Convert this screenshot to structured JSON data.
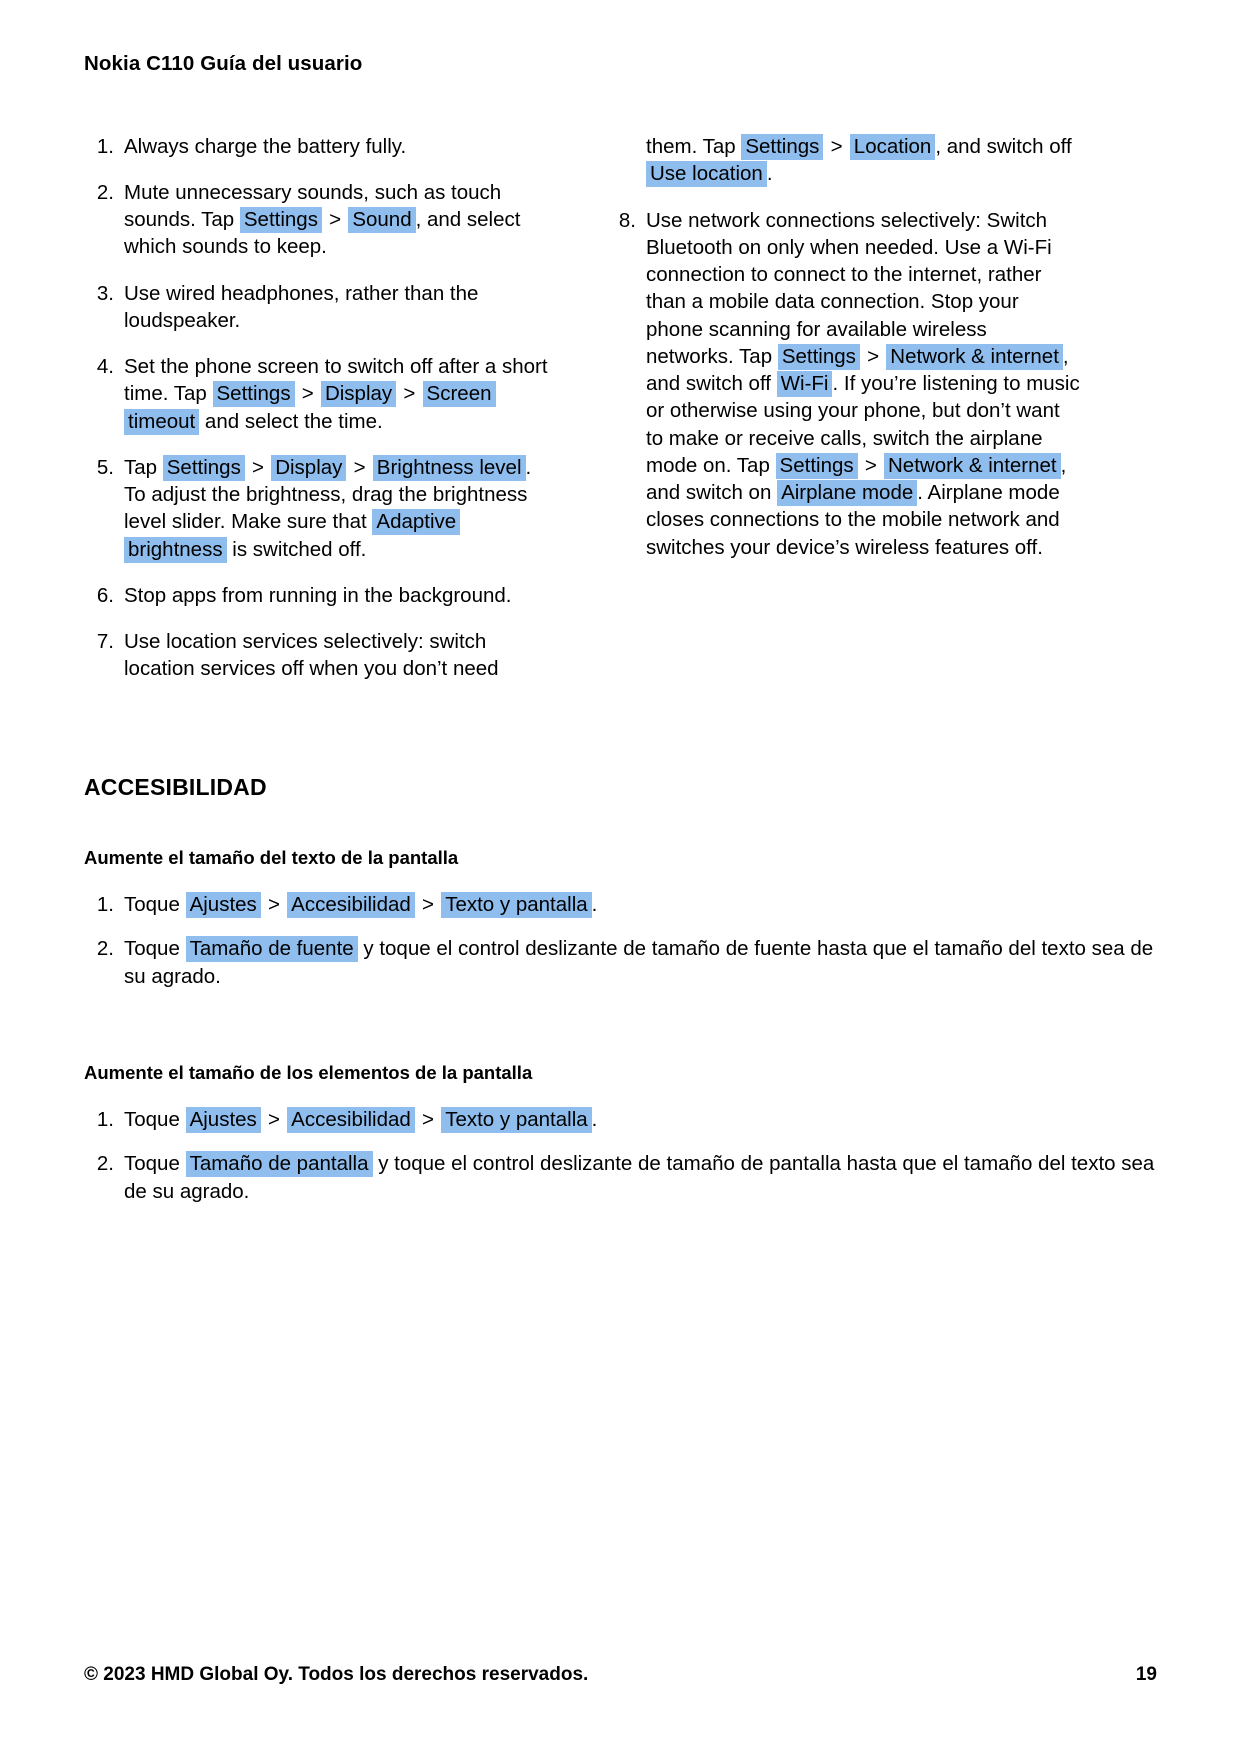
{
  "header": {
    "title": "Nokia C110 Guía del usuario"
  },
  "tips_left": [
    {
      "num": "1.",
      "parts": [
        {
          "t": "text",
          "v": "Always charge the battery fully."
        }
      ]
    },
    {
      "num": "2.",
      "parts": [
        {
          "t": "text",
          "v": "Mute unnecessary sounds, such as touch sounds. Tap "
        },
        {
          "t": "hl",
          "v": "Settings"
        },
        {
          "t": "sep",
          "v": ">"
        },
        {
          "t": "hl",
          "v": "Sound"
        },
        {
          "t": "text",
          "v": ", and select which sounds to keep."
        }
      ]
    },
    {
      "num": "3.",
      "parts": [
        {
          "t": "text",
          "v": "Use wired headphones, rather than the loudspeaker."
        }
      ]
    },
    {
      "num": "4.",
      "parts": [
        {
          "t": "text",
          "v": "Set the phone screen to switch off after a short time. Tap "
        },
        {
          "t": "hl",
          "v": "Settings"
        },
        {
          "t": "sep",
          "v": ">"
        },
        {
          "t": "hl",
          "v": "Display"
        },
        {
          "t": "sep",
          "v": ">"
        },
        {
          "t": "hl",
          "v": "Screen timeout"
        },
        {
          "t": "text",
          "v": " and select the time."
        }
      ]
    },
    {
      "num": "5.",
      "parts": [
        {
          "t": "text",
          "v": "Tap "
        },
        {
          "t": "hl",
          "v": "Settings"
        },
        {
          "t": "sep",
          "v": ">"
        },
        {
          "t": "hl",
          "v": "Display"
        },
        {
          "t": "sep",
          "v": ">"
        },
        {
          "t": "hl",
          "v": "Brightness level"
        },
        {
          "t": "text",
          "v": ". To adjust the brightness, drag the brightness level slider. Make sure that "
        },
        {
          "t": "hl",
          "v": "Adaptive brightness"
        },
        {
          "t": "text",
          "v": " is switched off."
        }
      ]
    },
    {
      "num": "6.",
      "parts": [
        {
          "t": "text",
          "v": "Stop apps from running in the background."
        }
      ]
    },
    {
      "num": "7.",
      "parts": [
        {
          "t": "text",
          "v": "Use location services selectively: switch location services off when you don’t need"
        }
      ]
    }
  ],
  "tips_right_continuation": {
    "parts": [
      {
        "t": "text",
        "v": "them. Tap "
      },
      {
        "t": "hl",
        "v": "Settings"
      },
      {
        "t": "sep",
        "v": ">"
      },
      {
        "t": "hl",
        "v": "Location"
      },
      {
        "t": "text",
        "v": ", and switch off "
      },
      {
        "t": "hl",
        "v": "Use location"
      },
      {
        "t": "text",
        "v": "."
      }
    ]
  },
  "tips_right": [
    {
      "num": "8.",
      "parts": [
        {
          "t": "text",
          "v": "Use network connections selectively: Switch Bluetooth on only when needed. Use a Wi-Fi connection to connect to the internet, rather than a mobile data connection. Stop your phone scanning for available wireless networks. Tap "
        },
        {
          "t": "hl",
          "v": "Settings"
        },
        {
          "t": "sep",
          "v": ">"
        },
        {
          "t": "hl",
          "v": "Network & internet"
        },
        {
          "t": "text",
          "v": ", and switch off "
        },
        {
          "t": "hl",
          "v": "Wi-Fi"
        },
        {
          "t": "text",
          "v": ". If you’re listening to music or otherwise using your phone, but don’t want to make or receive calls, switch the airplane mode on. Tap "
        },
        {
          "t": "hl",
          "v": "Settings"
        },
        {
          "t": "sep",
          "v": ">"
        },
        {
          "t": "hl",
          "v": "Network & internet"
        },
        {
          "t": "text",
          "v": ", and switch on "
        },
        {
          "t": "hl",
          "v": "Airplane mode"
        },
        {
          "t": "text",
          "v": ". Airplane mode closes connections to the mobile network and switches your device’s wireless features off."
        }
      ]
    }
  ],
  "accessibility": {
    "section_heading": "ACCESIBILIDAD",
    "groups": [
      {
        "subheading": "Aumente el tamaño del texto de la pantalla",
        "steps": [
          {
            "num": "1.",
            "parts": [
              {
                "t": "text",
                "v": "Toque "
              },
              {
                "t": "hl",
                "v": "Ajustes"
              },
              {
                "t": "sep",
                "v": ">"
              },
              {
                "t": "hl",
                "v": "Accesibilidad"
              },
              {
                "t": "sep",
                "v": ">"
              },
              {
                "t": "hl",
                "v": "Texto y pantalla"
              },
              {
                "t": "text",
                "v": "."
              }
            ]
          },
          {
            "num": "2.",
            "parts": [
              {
                "t": "text",
                "v": "Toque "
              },
              {
                "t": "hl",
                "v": "Tamaño de fuente"
              },
              {
                "t": "text",
                "v": " y toque el control deslizante de tamaño de fuente hasta que el tamaño del texto sea de su agrado."
              }
            ]
          }
        ]
      },
      {
        "subheading": "Aumente el tamaño de los elementos de la pantalla",
        "steps": [
          {
            "num": "1.",
            "parts": [
              {
                "t": "text",
                "v": "Toque "
              },
              {
                "t": "hl",
                "v": "Ajustes"
              },
              {
                "t": "sep",
                "v": ">"
              },
              {
                "t": "hl",
                "v": "Accesibilidad"
              },
              {
                "t": "sep",
                "v": ">"
              },
              {
                "t": "hl",
                "v": "Texto y pantalla"
              },
              {
                "t": "text",
                "v": "."
              }
            ]
          },
          {
            "num": "2.",
            "parts": [
              {
                "t": "text",
                "v": "Toque "
              },
              {
                "t": "hl",
                "v": "Tamaño de pantalla"
              },
              {
                "t": "text",
                "v": " y toque el control deslizante de tamaño de pantalla hasta que el tamaño del texto sea de su agrado."
              }
            ]
          }
        ]
      }
    ]
  },
  "footer": {
    "copyright": "© 2023 HMD Global Oy. Todos los derechos reservados.",
    "page_number": "19"
  },
  "colors": {
    "highlight": "#8fbeee",
    "text": "#000000",
    "background": "#ffffff"
  }
}
